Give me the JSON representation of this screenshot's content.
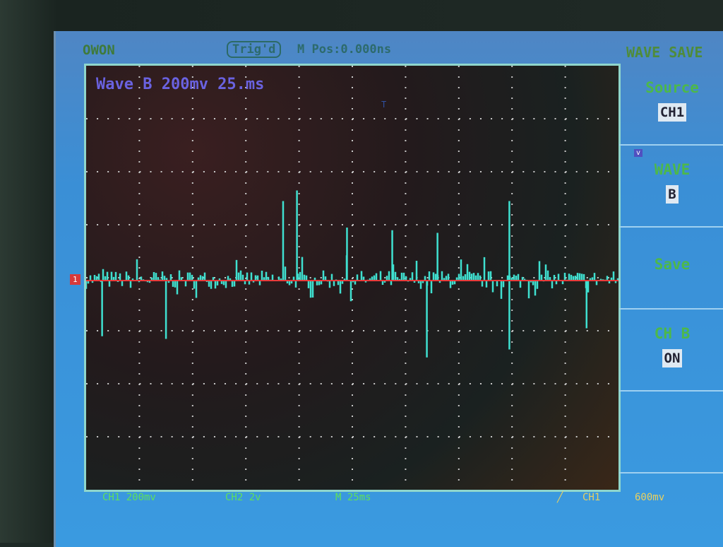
{
  "header": {
    "brand": "OWON",
    "trigger_status": "Trig'd",
    "m_pos": "M Pos:0.000ns",
    "menu_title": "WAVE SAVE"
  },
  "plot": {
    "label": "Wave B 200mv 25.ms",
    "ground_marker": "1",
    "trigger_marker": "T",
    "level_marker": "v",
    "major_spikes": [
      {
        "t": 0.37,
        "v": 1.5
      },
      {
        "t": 0.396,
        "v": 1.7
      },
      {
        "t": 0.49,
        "v": 1.0
      },
      {
        "t": 0.575,
        "v": 0.95
      },
      {
        "t": 0.66,
        "v": 0.9
      },
      {
        "t": 0.795,
        "v": 1.5
      },
      {
        "t": 0.64,
        "v": -1.45
      },
      {
        "t": 0.795,
        "v": -1.3
      },
      {
        "t": 0.03,
        "v": -1.05
      },
      {
        "t": 0.15,
        "v": -1.1
      },
      {
        "t": 0.94,
        "v": -0.9
      }
    ],
    "trace_color": "#3fe0d0",
    "ground_color": "#e83a3a"
  },
  "menu": [
    {
      "title": "Source",
      "value": "CH1"
    },
    {
      "title": "WAVE",
      "value": "B"
    },
    {
      "title": "Save",
      "value": ""
    },
    {
      "title": "CH B",
      "value": "ON"
    }
  ],
  "status": {
    "ch1": "CH1 200mv",
    "ch2": "CH2 2v",
    "time": "M 25ms",
    "trig_src": "CH1",
    "trig_level": "600mv"
  }
}
